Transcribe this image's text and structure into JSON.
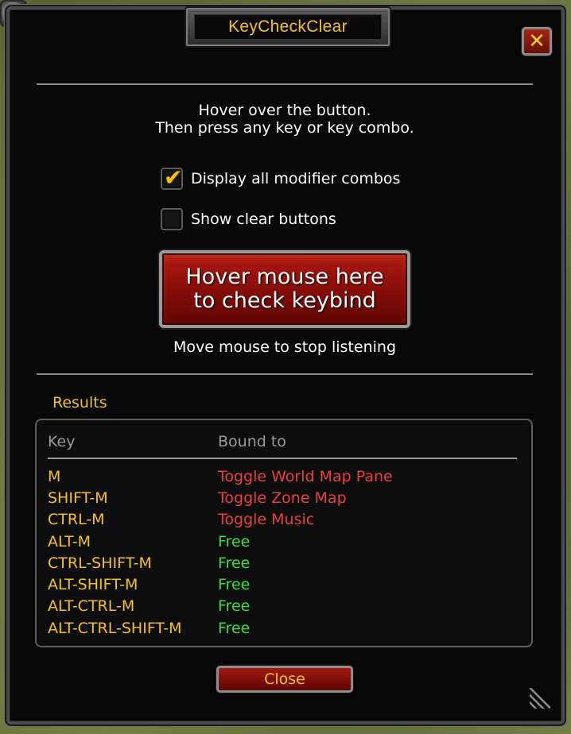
{
  "window": {
    "title": "KeyCheckClear",
    "close_icon": "close-x-icon"
  },
  "instructions": {
    "line1": "Hover over the button.",
    "line2": "Then press any key or key combo."
  },
  "options": {
    "display_all_modifier_combos": {
      "label": "Display all modifier combos",
      "checked": true
    },
    "show_clear_buttons": {
      "label": "Show clear buttons",
      "checked": false
    }
  },
  "hover_button": {
    "label": "Hover mouse here\nto check keybind"
  },
  "hint": "Move mouse to stop listening",
  "results": {
    "title": "Results",
    "columns": {
      "key": "Key",
      "bound_to": "Bound to"
    },
    "rows": [
      {
        "key": "M",
        "bound_to": "Toggle World Map Pane",
        "status": "bound"
      },
      {
        "key": "SHIFT-M",
        "bound_to": "Toggle Zone Map",
        "status": "bound"
      },
      {
        "key": "CTRL-M",
        "bound_to": "Toggle Music",
        "status": "bound"
      },
      {
        "key": "ALT-M",
        "bound_to": "Free",
        "status": "free"
      },
      {
        "key": "CTRL-SHIFT-M",
        "bound_to": "Free",
        "status": "free"
      },
      {
        "key": "ALT-SHIFT-M",
        "bound_to": "Free",
        "status": "free"
      },
      {
        "key": "ALT-CTRL-M",
        "bound_to": "Free",
        "status": "free"
      },
      {
        "key": "ALT-CTRL-SHIFT-M",
        "bound_to": "Free",
        "status": "free"
      }
    ]
  },
  "close_button": {
    "label": "Close"
  },
  "colors": {
    "gold": "#f4c21a",
    "bound": "#e8413a",
    "free": "#33e03a",
    "button_red": "#870d08"
  }
}
